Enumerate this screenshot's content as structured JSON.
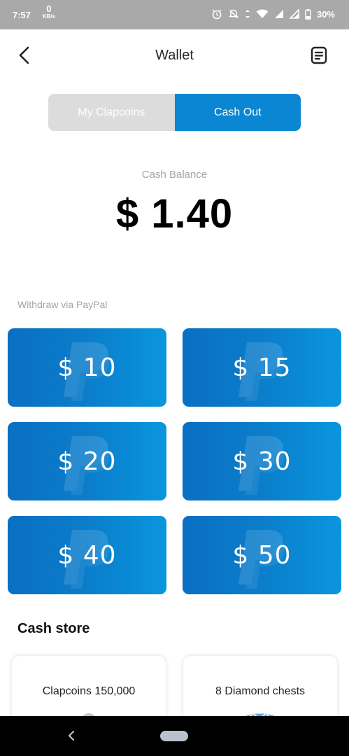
{
  "status_bar": {
    "time": "7:57",
    "net_speed": "0",
    "net_unit": "KB/s",
    "battery": "30%"
  },
  "header": {
    "title": "Wallet"
  },
  "tabs": [
    {
      "label": "My Clapcoins",
      "active": false
    },
    {
      "label": "Cash Out",
      "active": true
    }
  ],
  "balance": {
    "label": "Cash Balance",
    "value": "$ 1.40"
  },
  "withdraw": {
    "label": "Withdraw via PayPal",
    "options": [
      "$ 10",
      "$ 15",
      "$ 20",
      "$ 30",
      "$ 40",
      "$ 50"
    ]
  },
  "cash_store": {
    "title": "Cash store",
    "items": [
      "Clapcoins 150,000",
      "8 Diamond chests"
    ]
  },
  "colors": {
    "accent": "#0b86d2",
    "card_dark": "#0a6fc2",
    "card_light": "#0a96de",
    "status_bar": "#a9a9a9"
  }
}
